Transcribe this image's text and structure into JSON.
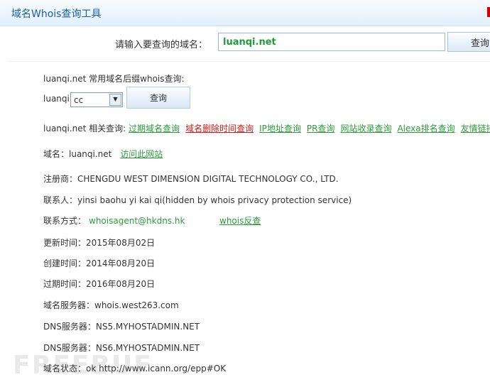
{
  "header": {
    "title": "域名Whois查询工具"
  },
  "search": {
    "label": "请输入要查询的域名：",
    "value": "luanqi.net",
    "button": "查询"
  },
  "suffix": {
    "title": "luanqi.net 常用域名后缀whois查询:",
    "prefix": "luanqi.",
    "selected": "cc",
    "button": "查询"
  },
  "related": {
    "label": "luanqi.net 相关查询:",
    "links": [
      {
        "text": "过期域名查询",
        "color": "#2e9b3a"
      },
      {
        "text": "域名删除时间查询",
        "color": "#d11a1a"
      },
      {
        "text": "IP地址查询",
        "color": "#2e9b3a"
      },
      {
        "text": "PR查询",
        "color": "#2e9b3a"
      },
      {
        "text": "网站收录查询",
        "color": "#2e9b3a"
      },
      {
        "text": "Alexa排名查询",
        "color": "#2e9b3a"
      },
      {
        "text": "友情链接检测",
        "color": "#2e9b3a"
      }
    ]
  },
  "domain": {
    "label": "域名：",
    "value": "luanqi.net",
    "visit_link": "访问此网站"
  },
  "registrar": {
    "label": "注册商：",
    "value": "CHENGDU WEST DIMENSION DIGITAL TECHNOLOGY CO., LTD."
  },
  "contact": {
    "label": "联系人：",
    "value": "yinsi baohu yi kai qi(hidden by whois privacy protection service)"
  },
  "contact_method": {
    "label": "联系方式：",
    "value": "whoisagent@hkdns.hk",
    "reverse_link": "whois反查"
  },
  "updated": {
    "label": "更新时间：",
    "value": "2015年08月02日"
  },
  "created": {
    "label": "创建时间：",
    "value": "2014年08月20日"
  },
  "expires": {
    "label": "过期时间：",
    "value": "2016年08月20日"
  },
  "whois_server": {
    "label": "域名服务器：",
    "value": "whois.west263.com"
  },
  "dns1": {
    "label": "DNS服务器：",
    "value": "NS5.MYHOSTADMIN.NET"
  },
  "dns2": {
    "label": "DNS服务器：",
    "value": "NS6.MYHOSTADMIN.NET"
  },
  "status": {
    "label": "域名状态：",
    "value": "ok http://www.icann.org/epp#OK"
  },
  "watermark": "FREEBUF",
  "colors": {
    "accent_blue": "#1b5fa8",
    "link_green": "#2e9b3a",
    "link_red": "#d11a1a"
  }
}
